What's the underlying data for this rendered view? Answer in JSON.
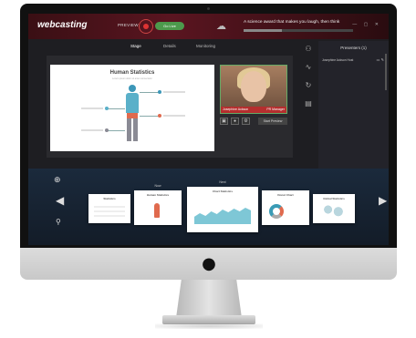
{
  "app": {
    "logo": "webcasting",
    "preview_label": "PREVIEW",
    "live_label": "Go Live",
    "event_title": "A science award that makes you laugh, then think",
    "progress_fraction": 0.35
  },
  "tabs": [
    {
      "label": "Stage"
    },
    {
      "label": "Details"
    },
    {
      "label": "Monitoring"
    }
  ],
  "stage_slide": {
    "title": "Human Statistics",
    "subtitle": "Lorem ipsum dolor sit amet consectetur"
  },
  "video": {
    "name": "Josephine Ackson",
    "role": "PR Manager",
    "start_label": "Start Preview"
  },
  "presenters": {
    "title": "Presenters (1)",
    "items": [
      {
        "name": "Josephine Ackson Host"
      }
    ]
  },
  "filmstrip": {
    "thumbs": [
      {
        "title": "Statistics",
        "caption": ""
      },
      {
        "title": "Human Statistics",
        "caption": "Now"
      },
      {
        "title": "Chart Statistics",
        "caption": "Next"
      },
      {
        "title": "Donut Chart",
        "caption": ""
      },
      {
        "title": "Global Statistics",
        "caption": ""
      }
    ]
  },
  "colors": {
    "accent": "#b52e2e",
    "live": "#4c9a4c",
    "chart": "#3a9bb5"
  },
  "icons": {
    "record": "record-icon",
    "cloud": "cloud-icon",
    "prev": "chevron-left-icon",
    "next": "chevron-right-icon",
    "apple": "apple-logo-icon"
  }
}
